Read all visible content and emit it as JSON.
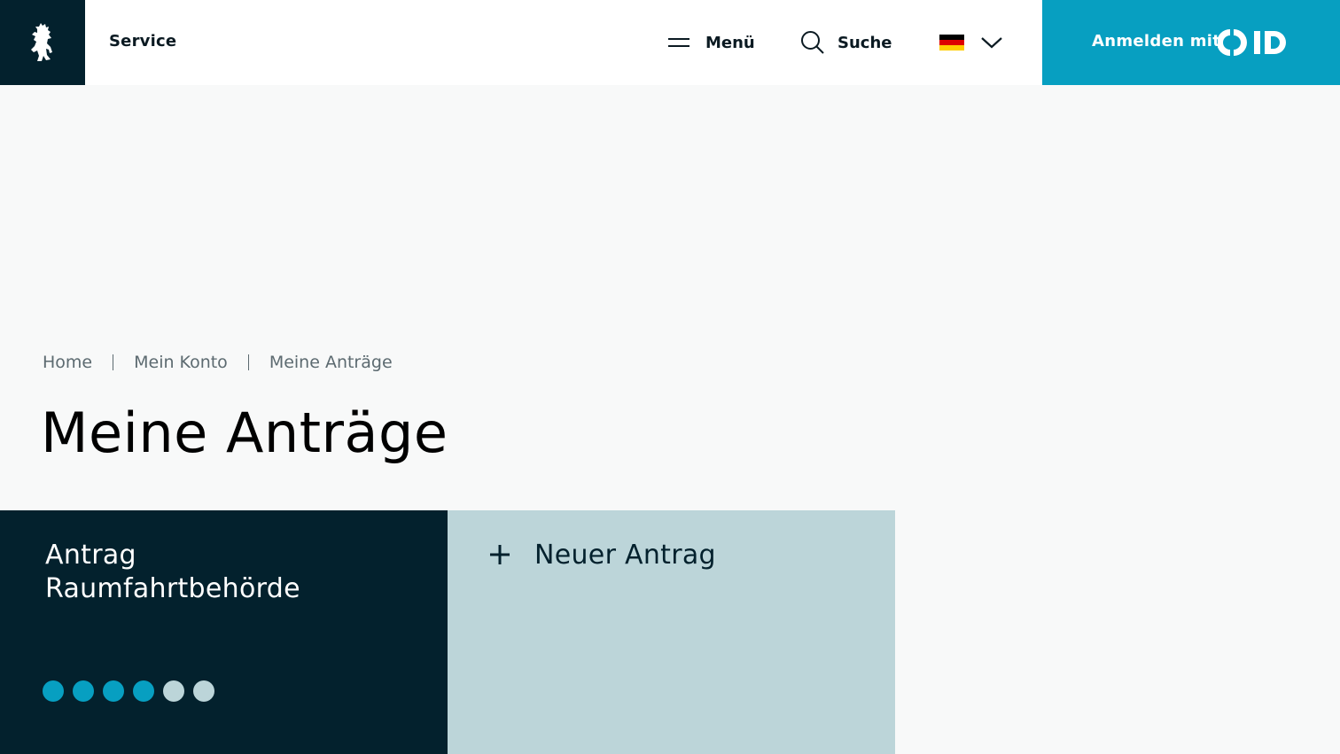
{
  "header": {
    "logo_icon": "berlin-bear-icon",
    "service_label": "Service",
    "menu_label": "Menü",
    "menu_icon": "hamburger-icon",
    "search_label": "Suche",
    "search_icon": "search-icon",
    "language_flag": "german-flag-icon",
    "language_chevron": "chevron-down-icon",
    "login_label": "Anmelden mit",
    "login_brand": "ID"
  },
  "breadcrumb": {
    "items": [
      "Home",
      "Mein Konto",
      "Meine Anträge"
    ]
  },
  "page": {
    "title": "Meine Anträge"
  },
  "cards": {
    "application": {
      "title_line1": "Antrag",
      "title_line2": "Raumfahrtbehörde",
      "progress_total": 6,
      "progress_completed": 4
    },
    "new_application": {
      "label": "Neuer Antrag",
      "icon": "plus-icon"
    }
  },
  "colors": {
    "dark_navy": "#03212d",
    "accent_blue": "#079fc1",
    "light_teal": "#bcd5d9",
    "page_bg": "#f8f9f9"
  }
}
